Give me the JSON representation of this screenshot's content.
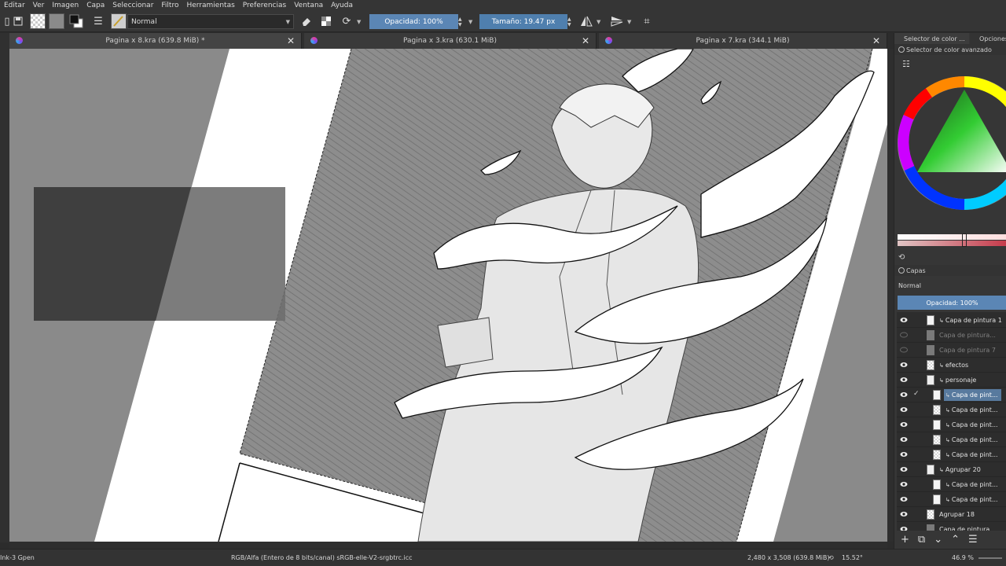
{
  "menubar": {
    "items": [
      "Editar",
      "Ver",
      "Imagen",
      "Capa",
      "Seleccionar",
      "Filtro",
      "Herramientas",
      "Preferencias",
      "Ventana",
      "Ayuda"
    ]
  },
  "toolbar": {
    "blend_mode": "Normal",
    "opacity_label": "Opacidad: 100%",
    "size_label": "Tamaño: 19.47 px",
    "accent": "#5b86b5"
  },
  "tabs": [
    {
      "label": "Pagina x 8.kra (639.8 MiB) *"
    },
    {
      "label": "Pagina x 3.kra (630.1 MiB)"
    },
    {
      "label": "Pagina x 7.kra (344.1 MiB)"
    }
  ],
  "docker": {
    "tabs": [
      "Selector de color ...",
      "Opciones de"
    ],
    "color_selector_title": "Selector de color avanzado",
    "layers_title": "Capas",
    "layers_blend_mode": "Normal",
    "layers_opacity": "Opacidad:  100%",
    "layers": [
      {
        "name": "Capa de pintura 1",
        "visible": true,
        "thumb": "white",
        "clip": true
      },
      {
        "name": "Capa de pintura...",
        "visible": false,
        "thumb": "grey",
        "clip": false
      },
      {
        "name": "Capa de pintura 7",
        "visible": false,
        "thumb": "grey",
        "clip": false
      },
      {
        "name": "efectos",
        "visible": true,
        "thumb": "checker",
        "clip": true
      },
      {
        "name": "personaje",
        "visible": true,
        "thumb": "group",
        "clip": true
      },
      {
        "name": "Capa de pint...",
        "visible": true,
        "thumb": "white",
        "clip": true,
        "selected": true
      },
      {
        "name": "Capa de pint...",
        "visible": true,
        "thumb": "checker",
        "clip": true
      },
      {
        "name": "Capa de pint...",
        "visible": true,
        "thumb": "white",
        "clip": true
      },
      {
        "name": "Capa de pint...",
        "visible": true,
        "thumb": "checker",
        "clip": true
      },
      {
        "name": "Capa de pint...",
        "visible": true,
        "thumb": "checker",
        "clip": true
      },
      {
        "name": "Agrupar 20",
        "visible": true,
        "thumb": "group",
        "clip": true
      },
      {
        "name": "Capa de pint...",
        "visible": true,
        "thumb": "white",
        "clip": true
      },
      {
        "name": "Capa de pint...",
        "visible": true,
        "thumb": "white",
        "clip": true
      },
      {
        "name": "Agrupar 18",
        "visible": true,
        "thumb": "checker",
        "clip": false
      },
      {
        "name": "Capa de pintura",
        "visible": true,
        "thumb": "grey",
        "clip": false
      }
    ]
  },
  "statusbar": {
    "brush": "Ink-3 Gpen",
    "color_info": "RGB/Alfa (Entero de 8 bits/canal)  sRGB-elle-V2-srgbtrc.icc",
    "dimensions": "2,480 x 3,508 (639.8 MiB)",
    "rotation": "15.52°",
    "zoom": "46.9 %"
  }
}
